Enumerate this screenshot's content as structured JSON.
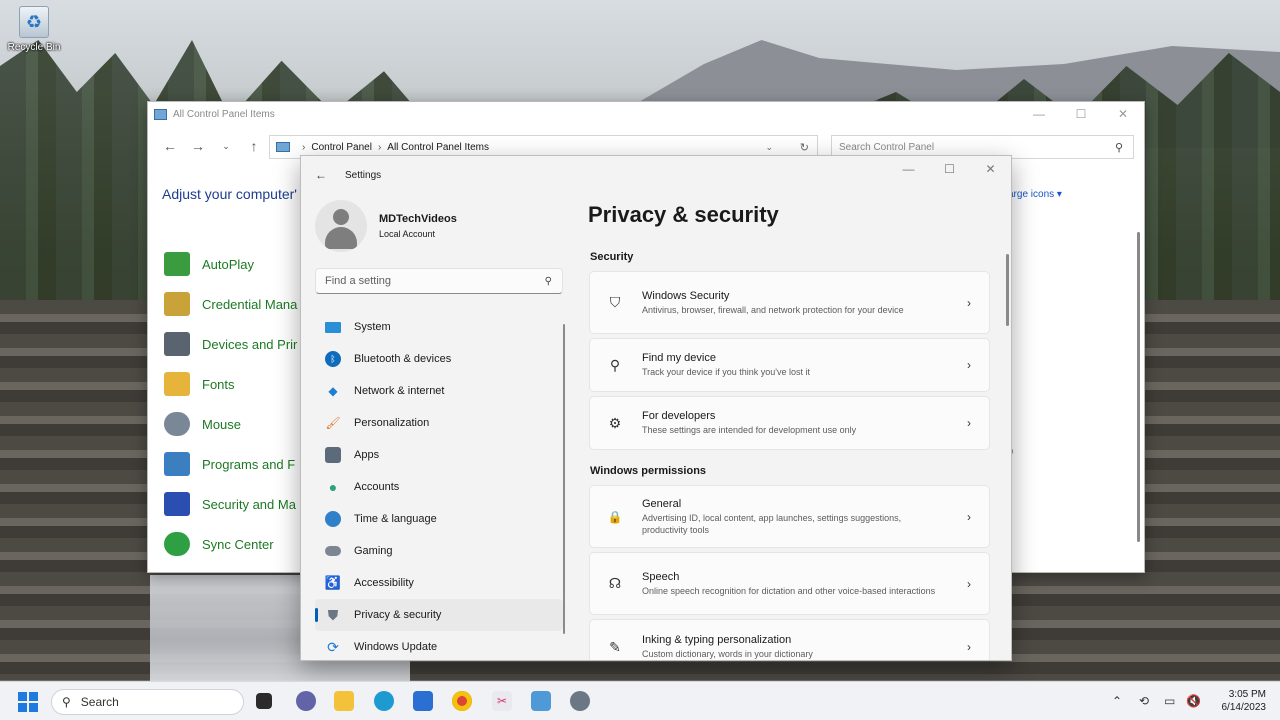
{
  "desktop": {
    "recycle_label": "Recycle Bin"
  },
  "control_panel": {
    "title": "All Control Panel Items",
    "controls": {
      "minimize": "—",
      "maximize": "☐",
      "close": "✕"
    },
    "breadcrumb": [
      "Control Panel",
      "All Control Panel Items"
    ],
    "search_placeholder": "Search Control Panel",
    "adjust_text": "Adjust your computer'",
    "view_by": "arge icons ▾",
    "items": [
      {
        "label": "AutoPlay",
        "icon": "autoplay-icon",
        "color": "#3a9b3f"
      },
      {
        "label": "Credential Mana",
        "icon": "credential-icon",
        "color": "#c9a23a"
      },
      {
        "label": "Devices and Prir",
        "icon": "devices-icon",
        "color": "#5a6470"
      },
      {
        "label": "Fonts",
        "icon": "fonts-icon",
        "color": "#e6b43a"
      },
      {
        "label": "Mouse",
        "icon": "mouse-icon",
        "color": "#7a8796"
      },
      {
        "label": "Programs and F",
        "icon": "programs-icon",
        "color": "#3b7fc0"
      },
      {
        "label": "Security and Ma",
        "icon": "flag-icon",
        "color": "#2a4fb0"
      },
      {
        "label": "Sync Center",
        "icon": "sync-icon",
        "color": "#2ea043"
      }
    ],
    "extra_text": "p"
  },
  "settings": {
    "window_title": "Settings",
    "user": {
      "name": "MDTechVideos",
      "type": "Local Account"
    },
    "find_placeholder": "Find a setting",
    "nav": [
      {
        "label": "System",
        "icon": "system-icon",
        "color": "#2b8fd6"
      },
      {
        "label": "Bluetooth & devices",
        "icon": "bluetooth-icon",
        "color": "#0f6cbd"
      },
      {
        "label": "Network & internet",
        "icon": "wifi-icon",
        "color": "#1d7fd4"
      },
      {
        "label": "Personalization",
        "icon": "brush-icon",
        "color": "#e0782f"
      },
      {
        "label": "Apps",
        "icon": "apps-icon",
        "color": "#5b6b7c"
      },
      {
        "label": "Accounts",
        "icon": "accounts-icon",
        "color": "#29a37a"
      },
      {
        "label": "Time & language",
        "icon": "globe-icon",
        "color": "#2f80c9"
      },
      {
        "label": "Gaming",
        "icon": "gaming-icon",
        "color": "#7c8692"
      },
      {
        "label": "Accessibility",
        "icon": "accessibility-icon",
        "color": "#1d6fb8"
      },
      {
        "label": "Privacy & security",
        "icon": "shield-icon",
        "color": "#6b7785",
        "selected": true
      },
      {
        "label": "Windows Update",
        "icon": "update-icon",
        "color": "#1c7ad6"
      }
    ],
    "page_title": "Privacy & security",
    "sections": {
      "security": "Security",
      "permissions": "Windows permissions"
    },
    "cards": [
      {
        "title": "Windows Security",
        "desc": "Antivirus, browser, firewall, and network protection for your device",
        "icon": "shield-outline-icon",
        "glyph": "⛉"
      },
      {
        "title": "Find my device",
        "desc": "Track your device if you think you've lost it",
        "icon": "person-location-icon",
        "glyph": "⚲"
      },
      {
        "title": "For developers",
        "desc": "These settings are intended for development use only",
        "icon": "developer-tools-icon",
        "glyph": "⚙"
      },
      {
        "title": "General",
        "desc": "Advertising ID, local content, app launches, settings suggestions, productivity tools",
        "icon": "lock-icon",
        "glyph": "🔒"
      },
      {
        "title": "Speech",
        "desc": "Online speech recognition for dictation and other voice-based interactions",
        "icon": "speech-icon",
        "glyph": "☊"
      },
      {
        "title": "Inking & typing personalization",
        "desc": "Custom dictionary, words in your dictionary",
        "icon": "inking-icon",
        "glyph": "✎"
      }
    ],
    "accent": "#005fb8"
  },
  "taskbar": {
    "search_label": "Search",
    "apps": [
      "task-view-icon",
      "chat-icon",
      "file-explorer-icon",
      "edge-icon",
      "store-icon",
      "chrome-icon",
      "snipping-tool-icon",
      "control-panel-icon",
      "settings-icon"
    ],
    "time": "3:05 PM",
    "date": "6/14/2023"
  }
}
